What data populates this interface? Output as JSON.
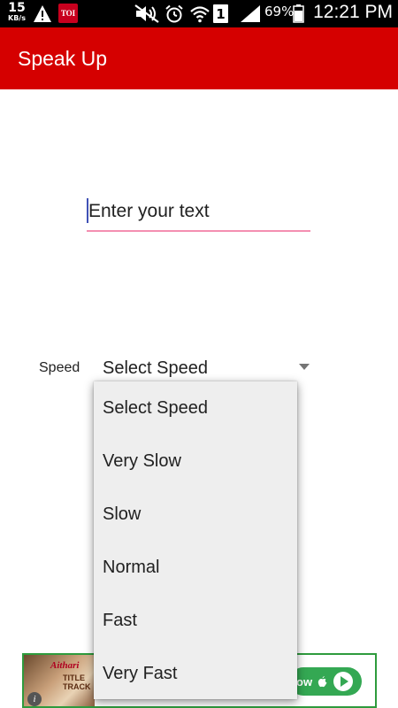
{
  "status_bar": {
    "net_speed_value": "15",
    "net_speed_unit": "KB/s",
    "notification_badge": "TOI",
    "sim_label": "1",
    "battery_percent": "69%",
    "time": "12:21 PM"
  },
  "app_bar": {
    "title": "Speak Up"
  },
  "text_input": {
    "placeholder": "Enter your text",
    "value": ""
  },
  "speed": {
    "label": "Speed",
    "selected": "Select Speed",
    "options": [
      "Select Speed",
      "Very Slow",
      "Slow",
      "Normal",
      "Fast",
      "Very Fast"
    ]
  },
  "ad": {
    "cta_label": "ow",
    "thumb_title": "Aithari",
    "thumb_subtitle": "TITLE TRACK"
  },
  "colors": {
    "app_bar": "#d50000",
    "underline": "#f48fb1",
    "popup_bg": "#eeeeee",
    "ad_accent": "#34a853"
  }
}
